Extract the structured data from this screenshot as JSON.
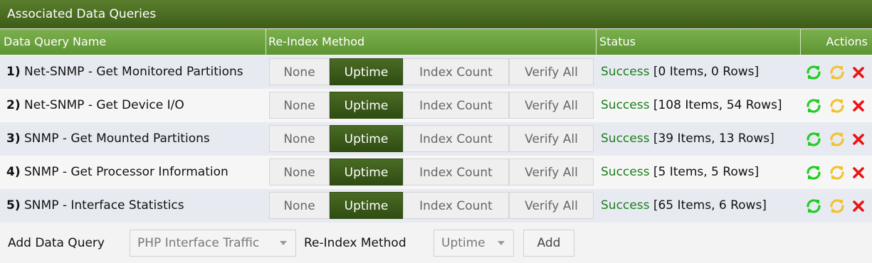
{
  "title": "Associated Data Queries",
  "headers": {
    "name": "Data Query Name",
    "method": "Re-Index Method",
    "status": "Status",
    "actions": "Actions"
  },
  "method_options": [
    "None",
    "Uptime",
    "Index Count",
    "Verify All"
  ],
  "rows": [
    {
      "num": "1)",
      "name": "Net-SNMP - Get Monitored Partitions",
      "selected": "Uptime",
      "status": "Success",
      "detail": "[0 Items, 0 Rows]"
    },
    {
      "num": "2)",
      "name": "Net-SNMP - Get Device I/O",
      "selected": "Uptime",
      "status": "Success",
      "detail": "[108 Items, 54 Rows]"
    },
    {
      "num": "3)",
      "name": "SNMP - Get Mounted Partitions",
      "selected": "Uptime",
      "status": "Success",
      "detail": "[39 Items, 13 Rows]"
    },
    {
      "num": "4)",
      "name": "SNMP - Get Processor Information",
      "selected": "Uptime",
      "status": "Success",
      "detail": "[5 Items, 5 Rows]"
    },
    {
      "num": "5)",
      "name": "SNMP - Interface Statistics",
      "selected": "Uptime",
      "status": "Success",
      "detail": "[65 Items, 6 Rows]"
    }
  ],
  "row_action_icons": [
    "reload-query-icon",
    "verbose-reload-icon",
    "delete-icon"
  ],
  "add_form": {
    "label": "Add Data Query",
    "query_selected": "PHP Interface Traffic",
    "method_label": "Re-Index Method",
    "method_selected": "Uptime",
    "add_button": "Add"
  },
  "colors": {
    "title_bar": "#3d5d17",
    "header_bar": "#6aa03c",
    "selected_button": "#3a5a1a",
    "success_text": "#1b7d1b",
    "reload_icon": "#22cc22",
    "verbose_icon": "#f2c230",
    "delete_icon": "#ee1111"
  }
}
